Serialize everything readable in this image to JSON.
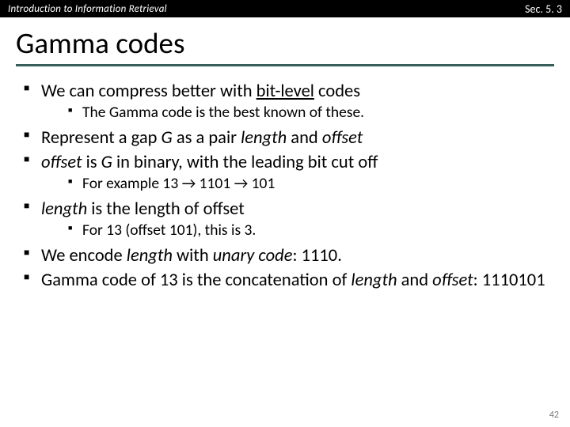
{
  "topbar": {
    "left": "Introduction to Information Retrieval",
    "right": "Sec. 5. 3"
  },
  "title": "Gamma codes",
  "b1": {
    "pre": "We can compress better with ",
    "ul": "bit-level",
    "post": " codes",
    "sub": "The Gamma code is the best known of these."
  },
  "b2": {
    "pre": "Represent a gap ",
    "G": "G",
    "mid": " as a pair ",
    "len": "length",
    "and": " and ",
    "off": "offset"
  },
  "b3": {
    "off": "offset",
    "mid": " is ",
    "G": "G",
    "post": " in binary, with the leading bit cut off",
    "sub": "For example 13 → 1101 → 101"
  },
  "b4": {
    "len": "length",
    "mid": " is the length of offset",
    "sub": "For 13 (offset 101), this is 3."
  },
  "b5": {
    "pre": "We encode ",
    "len": "length",
    "mid": " with ",
    "uc": "unary code",
    "post": ": 1110."
  },
  "b6": {
    "pre": "Gamma code of 13 is the concatenation of ",
    "len": "length",
    "and": " and ",
    "off": "offset",
    "post": ": 1110101"
  },
  "pagenum": "42"
}
